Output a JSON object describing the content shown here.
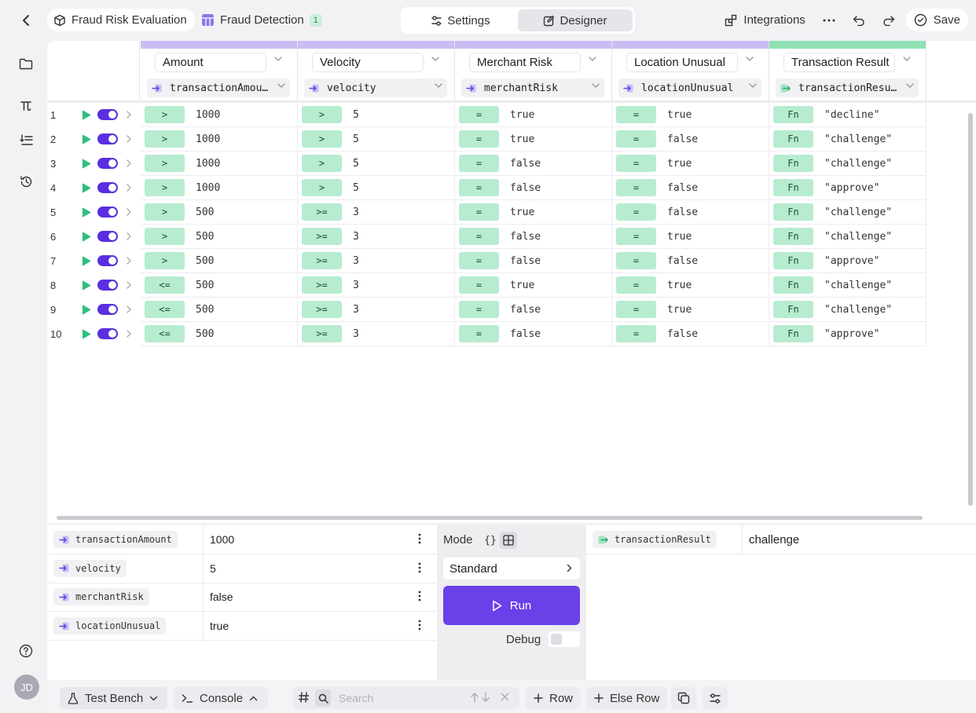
{
  "topbar": {
    "project_name": "Fraud Risk Evaluation",
    "decision_name": "Fraud Detection",
    "decision_count": "1",
    "tabs": [
      {
        "label": "Settings",
        "active": false
      },
      {
        "label": "Designer",
        "active": true
      }
    ],
    "integrations_label": "Integrations",
    "save_label": "Save"
  },
  "user": {
    "initials": "JD"
  },
  "table": {
    "columns": [
      {
        "title": "Amount",
        "field": "transactionAmou…",
        "kind": "input"
      },
      {
        "title": "Velocity",
        "field": "velocity",
        "kind": "input"
      },
      {
        "title": "Merchant Risk",
        "field": "merchantRisk",
        "kind": "input"
      },
      {
        "title": "Location Unusual",
        "field": "locationUnusual",
        "kind": "input"
      },
      {
        "title": "Transaction Result",
        "field": "transactionResu…",
        "kind": "output"
      }
    ],
    "rows": [
      {
        "num": "1",
        "c": [
          [
            ">",
            "1000"
          ],
          [
            ">",
            "5"
          ],
          [
            "=",
            "true"
          ],
          [
            "=",
            "true"
          ],
          [
            "Fn",
            "\"decline\""
          ]
        ]
      },
      {
        "num": "2",
        "c": [
          [
            ">",
            "1000"
          ],
          [
            ">",
            "5"
          ],
          [
            "=",
            "true"
          ],
          [
            "=",
            "false"
          ],
          [
            "Fn",
            "\"challenge\""
          ]
        ]
      },
      {
        "num": "3",
        "c": [
          [
            ">",
            "1000"
          ],
          [
            ">",
            "5"
          ],
          [
            "=",
            "false"
          ],
          [
            "=",
            "true"
          ],
          [
            "Fn",
            "\"challenge\""
          ]
        ]
      },
      {
        "num": "4",
        "c": [
          [
            ">",
            "1000"
          ],
          [
            ">",
            "5"
          ],
          [
            "=",
            "false"
          ],
          [
            "=",
            "false"
          ],
          [
            "Fn",
            "\"approve\""
          ]
        ]
      },
      {
        "num": "5",
        "c": [
          [
            ">",
            "500"
          ],
          [
            ">=",
            "3"
          ],
          [
            "=",
            "true"
          ],
          [
            "=",
            "false"
          ],
          [
            "Fn",
            "\"challenge\""
          ]
        ]
      },
      {
        "num": "6",
        "c": [
          [
            ">",
            "500"
          ],
          [
            ">=",
            "3"
          ],
          [
            "=",
            "false"
          ],
          [
            "=",
            "true"
          ],
          [
            "Fn",
            "\"challenge\""
          ]
        ]
      },
      {
        "num": "7",
        "c": [
          [
            ">",
            "500"
          ],
          [
            ">=",
            "3"
          ],
          [
            "=",
            "false"
          ],
          [
            "=",
            "false"
          ],
          [
            "Fn",
            "\"approve\""
          ]
        ]
      },
      {
        "num": "8",
        "c": [
          [
            "<=",
            "500"
          ],
          [
            ">=",
            "3"
          ],
          [
            "=",
            "true"
          ],
          [
            "=",
            "true"
          ],
          [
            "Fn",
            "\"challenge\""
          ]
        ]
      },
      {
        "num": "9",
        "c": [
          [
            "<=",
            "500"
          ],
          [
            ">=",
            "3"
          ],
          [
            "=",
            "false"
          ],
          [
            "=",
            "true"
          ],
          [
            "Fn",
            "\"challenge\""
          ]
        ]
      },
      {
        "num": "10",
        "c": [
          [
            "<=",
            "500"
          ],
          [
            ">=",
            "3"
          ],
          [
            "=",
            "false"
          ],
          [
            "=",
            "false"
          ],
          [
            "Fn",
            "\"approve\""
          ]
        ]
      }
    ]
  },
  "bench": {
    "inputs": [
      {
        "name": "transactionAmount",
        "value": "1000"
      },
      {
        "name": "velocity",
        "value": "5"
      },
      {
        "name": "merchantRisk",
        "value": "false"
      },
      {
        "name": "locationUnusual",
        "value": "true"
      }
    ],
    "mode_label": "Mode",
    "mode_json_glyph": "{}",
    "mode_select": "Standard",
    "run_label": "Run",
    "debug_label": "Debug",
    "output": {
      "name": "transactionResult",
      "value": "challenge"
    }
  },
  "footer": {
    "test_bench_label": "Test Bench",
    "console_label": "Console",
    "search_placeholder": "Search",
    "row_label": "Row",
    "else_row_label": "Else Row"
  },
  "colors": {
    "accent": "#6a40e8",
    "toggle_on": "#5a2fe0",
    "input_bar": "#c9bdf3",
    "output_bar": "#8ee1b2",
    "op_chip": "#b7ecd0",
    "play_green": "#2fbf7a"
  }
}
